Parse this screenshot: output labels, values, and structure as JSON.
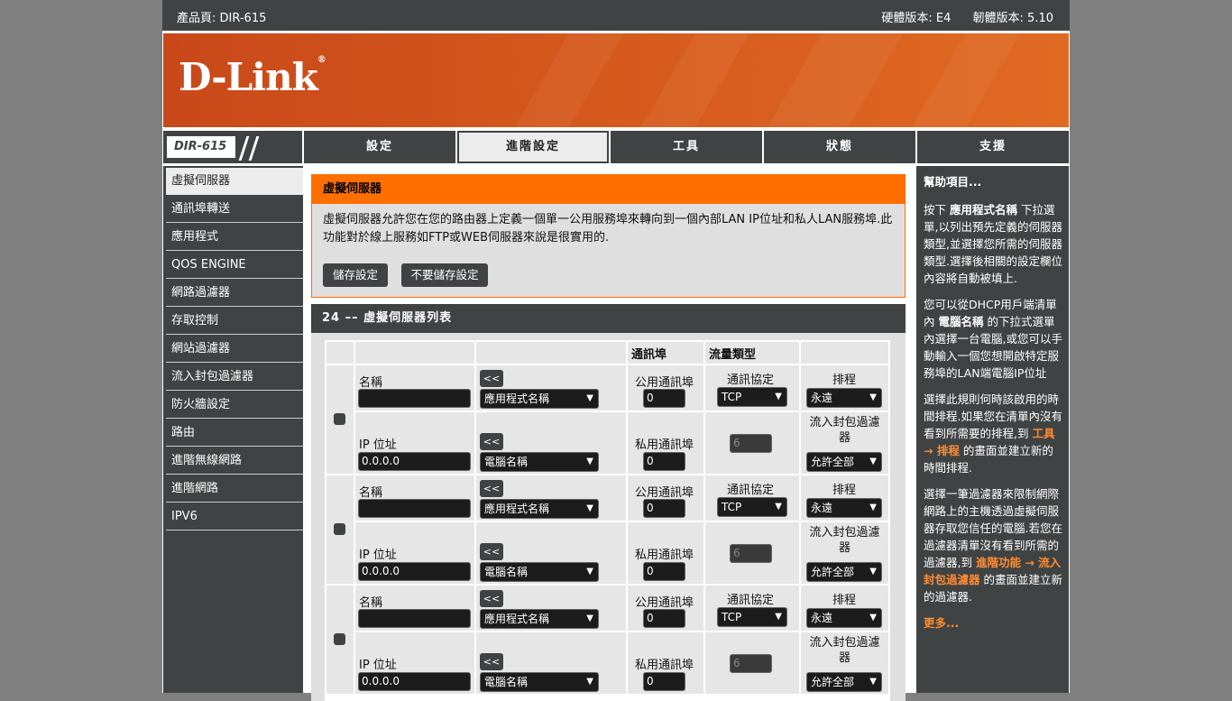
{
  "topbar": {
    "product": "產品頁: DIR-615",
    "hw": "硬體版本: E4",
    "fw": "韌體版本: 5.10"
  },
  "banner": {
    "logo": "D-Link"
  },
  "model": {
    "name": "DIR-615"
  },
  "tabs": [
    {
      "label": "設定"
    },
    {
      "label": "進階設定",
      "active": true
    },
    {
      "label": "工具"
    },
    {
      "label": "狀態"
    },
    {
      "label": "支援"
    }
  ],
  "sidebar": {
    "items": [
      {
        "label": "虛擬伺服器",
        "active": true
      },
      {
        "label": "通訊埠轉送"
      },
      {
        "label": "應用程式"
      },
      {
        "label": "QOS ENGINE"
      },
      {
        "label": "網路過濾器"
      },
      {
        "label": "存取控制"
      },
      {
        "label": "網站過濾器"
      },
      {
        "label": "流入封包過濾器"
      },
      {
        "label": "防火牆設定"
      },
      {
        "label": "路由"
      },
      {
        "label": "進階無線網路"
      },
      {
        "label": "進階網路"
      },
      {
        "label": "IPV6"
      }
    ]
  },
  "vs": {
    "title": "虛擬伺服器",
    "desc": "虛擬伺服器允許您在您的路由器上定義一個單一公用服務埠來轉向到一個內部LAN IP位址和私人LAN服務埠.此功能對於線上服務如FTP或WEB伺服器來說是很實用的.",
    "save": "儲存設定",
    "nosave": "不要儲存設定"
  },
  "list": {
    "title": "24 –– 虛擬伺服器列表",
    "col_port": "通訊埠",
    "col_traffic": "流量類型",
    "rows": [
      {
        "name_label": "名稱",
        "name_value": "",
        "app_select": "應用程式名稱",
        "public_label": "公用通訊埠",
        "public_value": "0",
        "protocol_label": "通訊協定",
        "protocol_value": "TCP",
        "schedule_label": "排程",
        "schedule_value": "永遠",
        "ip_label": "IP 位址",
        "ip_value": "0.0.0.0",
        "pc_select": "電腦名稱",
        "private_label": "私用通訊埠",
        "private_value": "0",
        "proto_num": "6",
        "filter_label": "流入封包過濾器",
        "filter_value": "允許全部",
        "add_btn": "<<"
      },
      {
        "name_label": "名稱",
        "name_value": "",
        "app_select": "應用程式名稱",
        "public_label": "公用通訊埠",
        "public_value": "0",
        "protocol_label": "通訊協定",
        "protocol_value": "TCP",
        "schedule_label": "排程",
        "schedule_value": "永遠",
        "ip_label": "IP 位址",
        "ip_value": "0.0.0.0",
        "pc_select": "電腦名稱",
        "private_label": "私用通訊埠",
        "private_value": "0",
        "proto_num": "6",
        "filter_label": "流入封包過濾器",
        "filter_value": "允許全部",
        "add_btn": "<<"
      },
      {
        "name_label": "名稱",
        "name_value": "",
        "app_select": "應用程式名稱",
        "public_label": "公用通訊埠",
        "public_value": "0",
        "protocol_label": "通訊協定",
        "protocol_value": "TCP",
        "schedule_label": "排程",
        "schedule_value": "永遠",
        "ip_label": "IP 位址",
        "ip_value": "0.0.0.0",
        "pc_select": "電腦名稱",
        "private_label": "私用通訊埠",
        "private_value": "0",
        "proto_num": "6",
        "filter_label": "流入封包過濾器",
        "filter_value": "允許全部",
        "add_btn": "<<"
      }
    ]
  },
  "help": {
    "title": "幫助項目...",
    "p1_a": "按下",
    "p1_b": "應用程式名稱",
    "p1_c": "下拉選單,以列出預先定義的伺服器類型,並選擇您所需的伺服器類型.選擇後相關的設定欄位內容將自動被填上.",
    "p2_a": "您可以從DHCP用戶端清單內",
    "p2_b": "電腦名稱",
    "p2_c": "的下拉式選單內選擇一台電腦,或您可以手動輸入一個您想開啟特定服務埠的LAN端電腦IP位址",
    "p3_a": "選擇此規則何時該啟用的時間排程.如果您在清單內沒有看到所需要的排程,到",
    "p3_link": "工具 → 排程",
    "p3_c": "的畫面並建立新的時間排程.",
    "p4_a": "選擇一筆過濾器來限制網際網路上的主機透過虛擬伺服器存取您信任的電腦.若您在過濾器清單沒有看到所需的過濾器,到",
    "p4_link": "進階功能 → 流入封包過濾器",
    "p4_c": "的畫面並建立新的過濾器.",
    "more": "更多..."
  }
}
